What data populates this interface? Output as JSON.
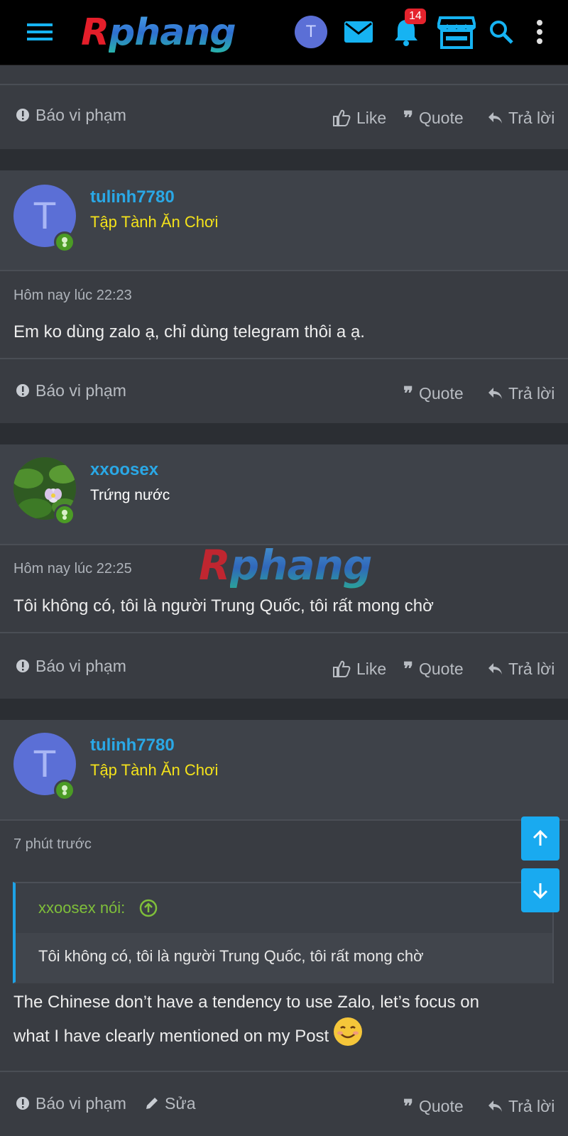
{
  "topbar": {
    "logo_r": "R",
    "logo_rest": "phang",
    "avatar_letter": "T",
    "notification_count": "14",
    "icons": [
      "menu-icon",
      "mail-icon",
      "bell-icon",
      "store-icon",
      "search-icon",
      "more-vertical-icon"
    ]
  },
  "actions": {
    "report": "Báo vi phạm",
    "like": "Like",
    "quote": "Quote",
    "reply": "Trả lời",
    "edit": "Sửa"
  },
  "posts": [
    {
      "username": "tulinh7780",
      "user_title": "Tập Tành Ăn Chơi",
      "avatar_letter": "T",
      "time": "Hôm nay lúc 22:23",
      "message": "Em ko dùng zalo ạ, chỉ dùng telegram thôi a ạ."
    },
    {
      "username": "xxoosex",
      "user_title": "Trứng nước",
      "time": "Hôm nay lúc 22:25",
      "message": "Tôi không có, tôi là người Trung Quốc, tôi rất mong chờ"
    },
    {
      "username": "tulinh7780",
      "user_title": "Tập Tành Ăn Chơi",
      "avatar_letter": "T",
      "time": "7 phút trước",
      "quote_author": "xxoosex nói:",
      "quote_text": "Tôi không có, tôi là người Trung Quốc, tôi rất mong chờ",
      "message_line1": "The Chinese don’t have a tendency to use Zalo, let’s focus on",
      "message_line2": "what I have clearly mentioned on my Post"
    }
  ],
  "watermark": {
    "r": "R",
    "rest": "phang"
  },
  "colors": {
    "accent": "#16b3f2",
    "username": "#2aa8e6",
    "rank_title": "#f4e21a",
    "online": "#4b9b25",
    "quote_author": "#7fbf3a"
  }
}
